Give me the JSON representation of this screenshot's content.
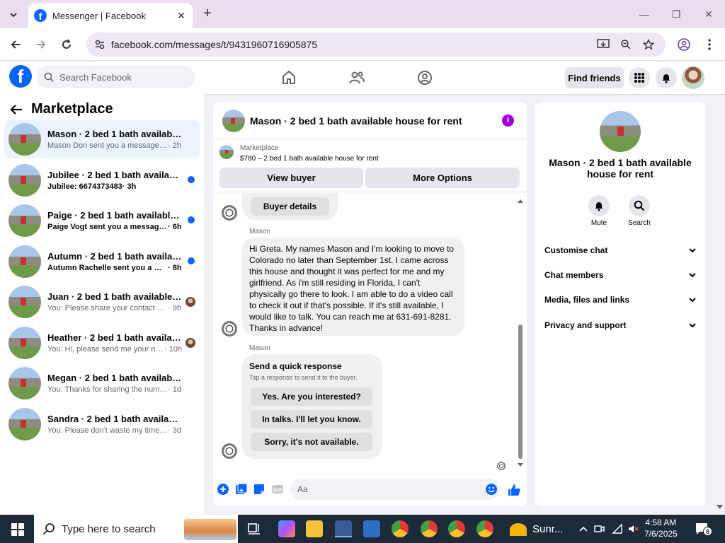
{
  "browser": {
    "tab_title": "Messenger | Facebook",
    "url": "facebook.com/messages/t/9431960716905875"
  },
  "fb": {
    "search_placeholder": "Search Facebook",
    "find_friends": "Find friends"
  },
  "sidebar": {
    "title": "Marketplace",
    "conversations": [
      {
        "name": "Mason · 2 bed 1 bath available hou...",
        "snippet": "Mason Don sent you a message abou...",
        "time": "· 2h"
      },
      {
        "name": "Jubilee · 2 bed 1 bath available h...",
        "snippet": "Jubilee: 6674373483",
        "time": "· 3h"
      },
      {
        "name": "Paige · 2 bed 1 bath available ho...",
        "snippet": "Paige Vogt sent you a message ab...",
        "time": "· 6h"
      },
      {
        "name": "Autumn · 2 bed 1 bath available ...",
        "snippet": "Autumn Rachelle sent you a messa...",
        "time": "· 8h"
      },
      {
        "name": "Juan · 2 bed 1 bath available ho...",
        "snippet": "You: Please share your contact num...",
        "time": "· 9h"
      },
      {
        "name": "Heather · 2 bed 1 bath available ...",
        "snippet": "You: Hi, please send me your num...",
        "time": "· 10h"
      },
      {
        "name": "Megan · 2 bed 1 bath available ho...",
        "snippet": "You: Thanks for sharing the number. I ...",
        "time": "· 1d"
      },
      {
        "name": "Sandra · 2 bed 1 bath available ho...",
        "snippet": "You: Please don't waste my time, if yo...",
        "time": "· 3d"
      }
    ]
  },
  "chat": {
    "title": "Mason · 2 bed 1 bath available house for rent",
    "marketplace_label": "Marketplace",
    "listing": "$780 – 2 bed 1 bath available house for rent",
    "view_buyer": "View buyer",
    "more_options": "More Options",
    "buyer_details": "Buyer details",
    "sender": "Mason",
    "message": "Hi Greta. My names Mason and I'm looking to move to Colorado no later than September 1st. I came across this house and thought it was perfect for me and my girlfriend. As i'm still residing in Florida, I can't physically go there to look. I am able to do a video call to check it out if that's possible. If it's still available, I would like to talk. You can reach me at 631-691-8281. Thanks in advance!",
    "sender2": "Mason",
    "qr_title": "Send a quick response",
    "qr_hint": "Tap a response to send it to the buyer.",
    "qr_options": [
      "Yes. Are you interested?",
      "In talks. I'll let you know.",
      "Sorry, it's not available."
    ],
    "input_placeholder": "Aa"
  },
  "info": {
    "title": "Mason · 2 bed 1 bath available house for rent",
    "mute": "Mute",
    "search": "Search",
    "sections": [
      "Customise chat",
      "Chat members",
      "Media, files and links",
      "Privacy and support"
    ]
  },
  "taskbar": {
    "search_placeholder": "Type here to search",
    "weather": "Sunr...",
    "time": "4:58 AM",
    "date": "7/6/2025",
    "notifications": "8"
  },
  "colors": {
    "fb_blue": "#0866ff",
    "info_purple": "#a000d8",
    "unread_blue": "#0866ff"
  }
}
